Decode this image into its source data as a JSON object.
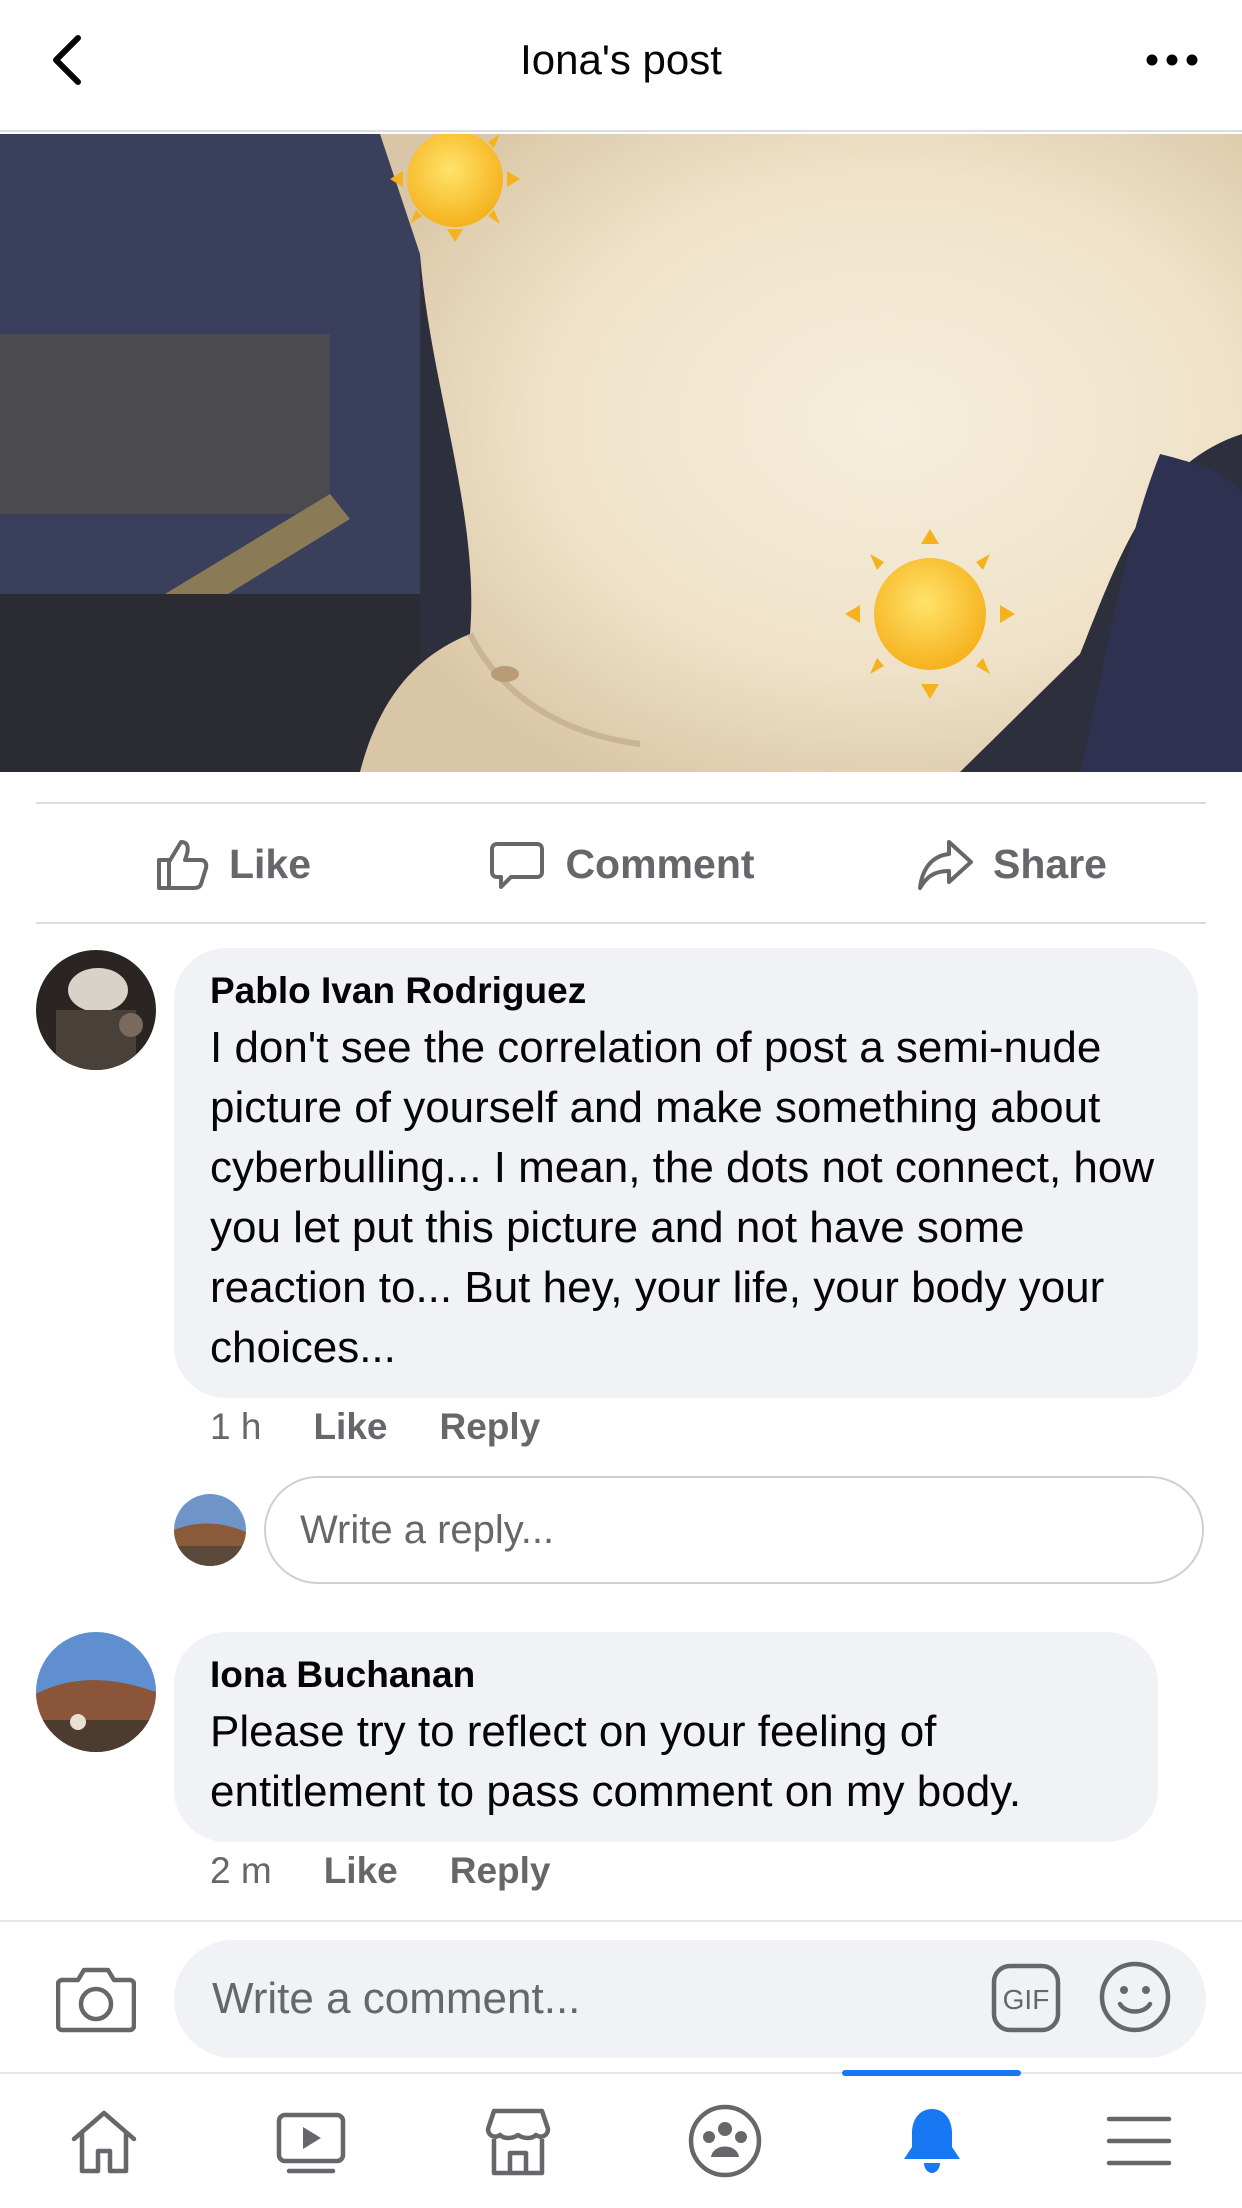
{
  "header": {
    "title": "Iona's post"
  },
  "actions": {
    "like": "Like",
    "comment": "Comment",
    "share": "Share"
  },
  "comments": [
    {
      "author": "Pablo Ivan Rodriguez",
      "text": "I don't see the correlation of post a semi-nude picture of yourself and make something about cyberbulling... I mean, the dots not connect, how you let put this picture and not have some reaction to... But hey, your life, your body your choices...",
      "time": "1 h",
      "like_label": "Like",
      "reply_label": "Reply"
    },
    {
      "author": "Iona Buchanan",
      "text": "Please try to reflect on your feeling of entitlement to pass comment on my body.",
      "time": "2 m",
      "like_label": "Like",
      "reply_label": "Reply"
    }
  ],
  "reply_box": {
    "placeholder": "Write a reply..."
  },
  "composer": {
    "placeholder": "Write a comment...",
    "gif_label": "GIF"
  },
  "tabbar": {
    "active": "notifications",
    "accent": "#1877f2"
  },
  "colors": {
    "bubble": "#f0f2f5",
    "secondary_text": "#65676b"
  }
}
